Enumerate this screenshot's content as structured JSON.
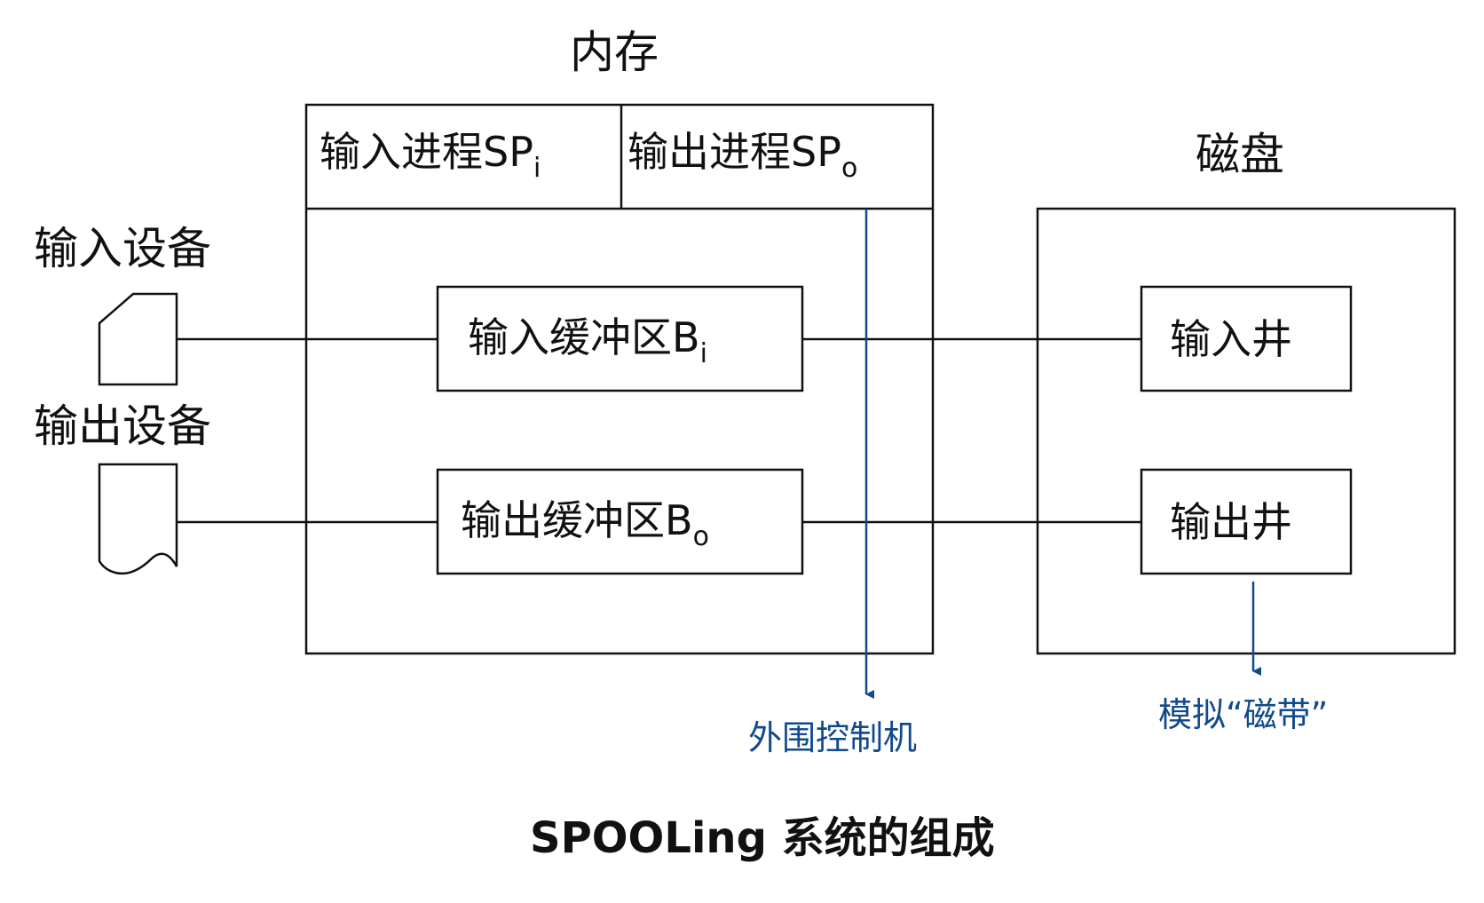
{
  "memory": {
    "title": "内存",
    "input_process": {
      "text": "输入进程SP",
      "sub": "i"
    },
    "output_process": {
      "text": "输出进程SP",
      "sub": "o"
    },
    "input_buffer": {
      "text": "输入缓冲区B",
      "sub": "i"
    },
    "output_buffer": {
      "text": "输出缓冲区B",
      "sub": "o"
    }
  },
  "disk": {
    "title": "磁盘",
    "input_well": "输入井",
    "output_well": "输出井"
  },
  "devices": {
    "input_device": "输入设备",
    "output_device": "输出设备"
  },
  "annotations": {
    "peripheral_machine": "外围控制机",
    "simulated_tape": "模拟“磁带”"
  },
  "caption": "SPOOLing 系统的组成",
  "colors": {
    "line": "#111111",
    "annotation": "#114a8c",
    "background": "#ffffff"
  }
}
